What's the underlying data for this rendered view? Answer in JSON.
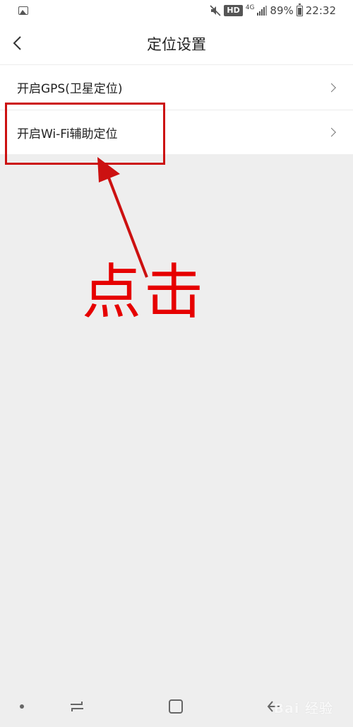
{
  "status_bar": {
    "hd_label": "HD",
    "network_label": "4G",
    "battery_percent": "89%",
    "time": "22:32",
    "icons": [
      "image-icon",
      "mute-icon",
      "signal-icon",
      "battery-icon"
    ]
  },
  "header": {
    "title": "定位设置",
    "back_icon": "chevron-left-icon"
  },
  "settings": {
    "items": [
      {
        "label": "开启GPS(卫星定位)"
      },
      {
        "label": "开启Wi-Fi辅助定位"
      }
    ]
  },
  "annotation": {
    "text": "点击",
    "color": "#e60000"
  },
  "nav_bar": {
    "icons": [
      "nav-dot",
      "recents-icon",
      "home-icon",
      "back-icon"
    ]
  },
  "watermark": {
    "text": "Bai 经验"
  }
}
